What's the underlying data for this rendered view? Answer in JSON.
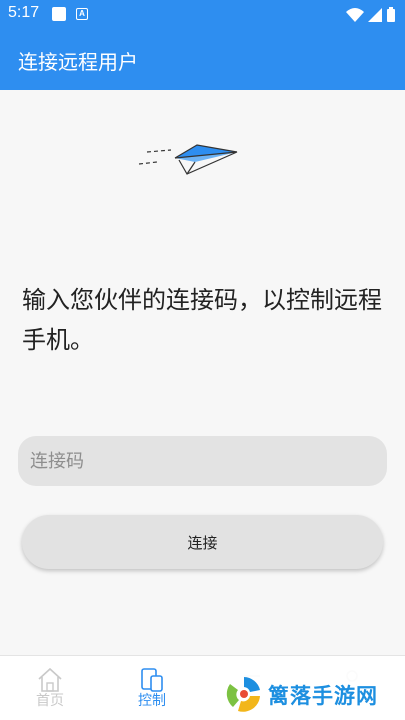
{
  "status_bar": {
    "time": "5:17",
    "notif_letter": "A"
  },
  "app_bar": {
    "title": "连接远程用户"
  },
  "main": {
    "prompt": "输入您伙伴的连接码，以控制远程手机。",
    "code_input": {
      "placeholder": "连接码",
      "value": ""
    },
    "connect_button": "连接"
  },
  "bottom_nav": {
    "items": [
      {
        "label": "首页",
        "icon": "home-icon",
        "active": false
      },
      {
        "label": "控制",
        "icon": "phone-control-icon",
        "active": true
      }
    ]
  },
  "watermark": {
    "text": "篱落手游网"
  },
  "colors": {
    "primary": "#2e8ef0",
    "input_bg": "#e3e3e3",
    "button_bg": "#e2e2e2",
    "background": "#f7f7f7"
  }
}
